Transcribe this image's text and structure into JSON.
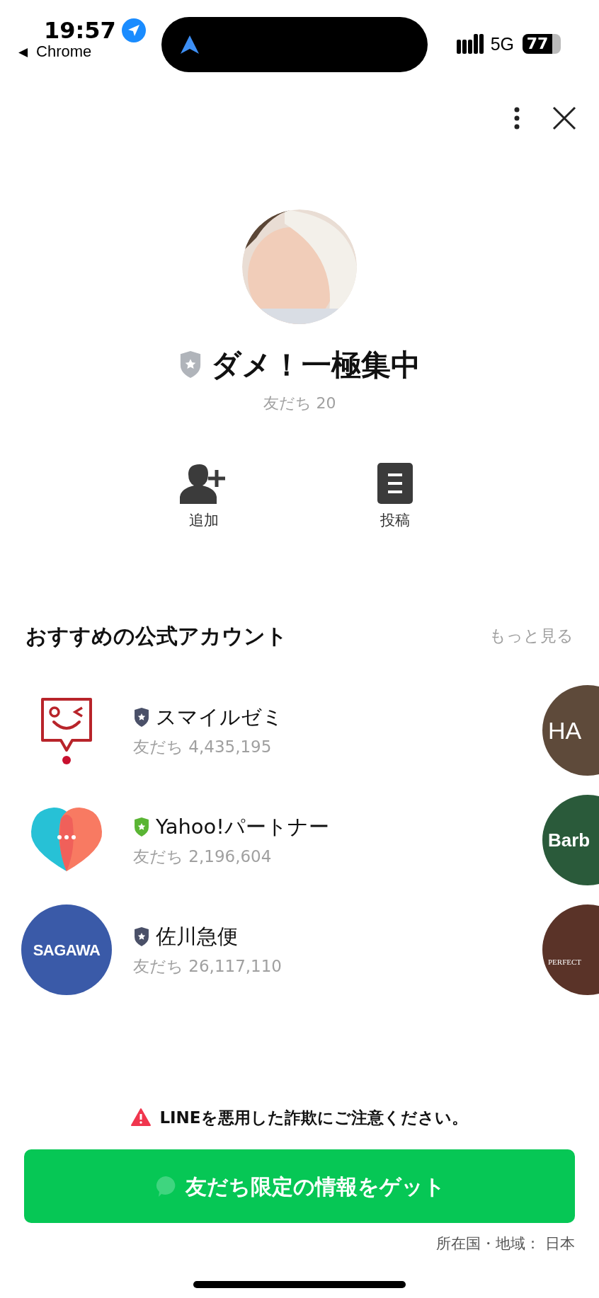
{
  "status_bar": {
    "time": "19:57",
    "back_arrow": "◀",
    "back_label": "Chrome",
    "network": "5G",
    "battery": "77"
  },
  "profile": {
    "color": "#b0b4ba",
    "name": "ダメ！一極集中",
    "friends": "友だち 20"
  },
  "actions": [
    {
      "kind": "add_friend",
      "label": "追加"
    },
    {
      "kind": "posts",
      "label": "投稿"
    }
  ],
  "recommended": {
    "title": "おすすめの公式アカウント",
    "more": "もっと見る",
    "accounts": [
      {
        "kind": "smile",
        "name": "スマイルゼミ",
        "color": "#4a5068",
        "friends": "友だち 4,435,195"
      },
      {
        "kind": "heart",
        "name": "Yahoo!パートナー",
        "color": "#5ab534",
        "friends": "友だち 2,196,604"
      },
      {
        "kind": "sagawa",
        "logo_text": "SAGAWA",
        "name": "佐川急便",
        "color": "#4a5068",
        "friends": "友だち 26,117,110"
      }
    ],
    "side_accounts": [
      {
        "logo_text": "HA",
        "color": "#5e4a3a"
      },
      {
        "logo_text": "Barb",
        "color": "#2a5a3a"
      },
      {
        "logo_text": "PERFECT",
        "color": "#5a3328"
      }
    ]
  },
  "warning": "LINEを悪用した詐欺にご注意ください。",
  "cta_button": "友だち限定の情報をゲット",
  "footer": "所在国・地域： 日本"
}
